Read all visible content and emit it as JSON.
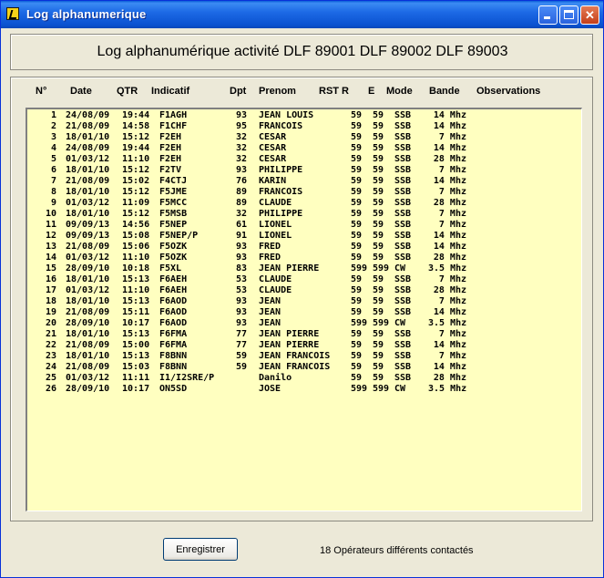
{
  "window": {
    "title": "Log alphanumerique"
  },
  "header": {
    "title": "Log alphanumérique activité  DLF 89001 DLF 89002 DLF 89003"
  },
  "columns": {
    "n": "N°",
    "date": "Date",
    "qtr": "QTR",
    "indicatif": "Indicatif",
    "dpt": "Dpt",
    "prenom": "Prenom",
    "rst_r": "RST R",
    "e": "E",
    "mode": "Mode",
    "bande": "Bande",
    "observations": "Observations"
  },
  "log": [
    {
      "n": "1",
      "date": "24/08/09",
      "qtr": "19:44",
      "ind": "F1AGH",
      "dpt": "93",
      "pre": "JEAN LOUIS",
      "r": "59",
      "e": "59",
      "mode": "SSB",
      "bande": "14 Mhz",
      "obs": ""
    },
    {
      "n": "2",
      "date": "21/08/09",
      "qtr": "14:58",
      "ind": "F1CHF",
      "dpt": "95",
      "pre": "FRANCOIS",
      "r": "59",
      "e": "59",
      "mode": "SSB",
      "bande": "14 Mhz",
      "obs": ""
    },
    {
      "n": "3",
      "date": "18/01/10",
      "qtr": "15:12",
      "ind": "F2EH",
      "dpt": "32",
      "pre": "CESAR",
      "r": "59",
      "e": "59",
      "mode": "SSB",
      "bande": "7 Mhz",
      "obs": ""
    },
    {
      "n": "4",
      "date": "24/08/09",
      "qtr": "19:44",
      "ind": "F2EH",
      "dpt": "32",
      "pre": "CESAR",
      "r": "59",
      "e": "59",
      "mode": "SSB",
      "bande": "14 Mhz",
      "obs": ""
    },
    {
      "n": "5",
      "date": "01/03/12",
      "qtr": "11:10",
      "ind": "F2EH",
      "dpt": "32",
      "pre": "CESAR",
      "r": "59",
      "e": "59",
      "mode": "SSB",
      "bande": "28 Mhz",
      "obs": ""
    },
    {
      "n": "6",
      "date": "18/01/10",
      "qtr": "15:12",
      "ind": "F2TV",
      "dpt": "93",
      "pre": "PHILIPPE",
      "r": "59",
      "e": "59",
      "mode": "SSB",
      "bande": "7 Mhz",
      "obs": ""
    },
    {
      "n": "7",
      "date": "21/08/09",
      "qtr": "15:02",
      "ind": "F4CTJ",
      "dpt": "76",
      "pre": "KARIN",
      "r": "59",
      "e": "59",
      "mode": "SSB",
      "bande": "14 Mhz",
      "obs": ""
    },
    {
      "n": "8",
      "date": "18/01/10",
      "qtr": "15:12",
      "ind": "F5JME",
      "dpt": "89",
      "pre": "FRANCOIS",
      "r": "59",
      "e": "59",
      "mode": "SSB",
      "bande": "7 Mhz",
      "obs": ""
    },
    {
      "n": "9",
      "date": "01/03/12",
      "qtr": "11:09",
      "ind": "F5MCC",
      "dpt": "89",
      "pre": "CLAUDE",
      "r": "59",
      "e": "59",
      "mode": "SSB",
      "bande": "28 Mhz",
      "obs": ""
    },
    {
      "n": "10",
      "date": "18/01/10",
      "qtr": "15:12",
      "ind": "F5MSB",
      "dpt": "32",
      "pre": "PHILIPPE",
      "r": "59",
      "e": "59",
      "mode": "SSB",
      "bande": "7 Mhz",
      "obs": ""
    },
    {
      "n": "11",
      "date": "09/09/13",
      "qtr": "14:56",
      "ind": "F5NEP",
      "dpt": "61",
      "pre": "LIONEL",
      "r": "59",
      "e": "59",
      "mode": "SSB",
      "bande": "7 Mhz",
      "obs": ""
    },
    {
      "n": "12",
      "date": "09/09/13",
      "qtr": "15:08",
      "ind": "F5NEP/P",
      "dpt": "91",
      "pre": "LIONEL",
      "r": "59",
      "e": "59",
      "mode": "SSB",
      "bande": "14 Mhz",
      "obs": ""
    },
    {
      "n": "13",
      "date": "21/08/09",
      "qtr": "15:06",
      "ind": "F5OZK",
      "dpt": "93",
      "pre": "FRED",
      "r": "59",
      "e": "59",
      "mode": "SSB",
      "bande": "14 Mhz",
      "obs": ""
    },
    {
      "n": "14",
      "date": "01/03/12",
      "qtr": "11:10",
      "ind": "F5OZK",
      "dpt": "93",
      "pre": "FRED",
      "r": "59",
      "e": "59",
      "mode": "SSB",
      "bande": "28 Mhz",
      "obs": ""
    },
    {
      "n": "15",
      "date": "28/09/10",
      "qtr": "10:18",
      "ind": "F5XL",
      "dpt": "83",
      "pre": "JEAN PIERRE",
      "r": "599",
      "e": "599",
      "mode": "CW",
      "bande": "3.5 Mhz",
      "obs": ""
    },
    {
      "n": "16",
      "date": "18/01/10",
      "qtr": "15:13",
      "ind": "F6AEH",
      "dpt": "53",
      "pre": "CLAUDE",
      "r": "59",
      "e": "59",
      "mode": "SSB",
      "bande": "7 Mhz",
      "obs": ""
    },
    {
      "n": "17",
      "date": "01/03/12",
      "qtr": "11:10",
      "ind": "F6AEH",
      "dpt": "53",
      "pre": "CLAUDE",
      "r": "59",
      "e": "59",
      "mode": "SSB",
      "bande": "28 Mhz",
      "obs": ""
    },
    {
      "n": "18",
      "date": "18/01/10",
      "qtr": "15:13",
      "ind": "F6AOD",
      "dpt": "93",
      "pre": "JEAN",
      "r": "59",
      "e": "59",
      "mode": "SSB",
      "bande": "7 Mhz",
      "obs": ""
    },
    {
      "n": "19",
      "date": "21/08/09",
      "qtr": "15:11",
      "ind": "F6AOD",
      "dpt": "93",
      "pre": "JEAN",
      "r": "59",
      "e": "59",
      "mode": "SSB",
      "bande": "14 Mhz",
      "obs": ""
    },
    {
      "n": "20",
      "date": "28/09/10",
      "qtr": "10:17",
      "ind": "F6AOD",
      "dpt": "93",
      "pre": "JEAN",
      "r": "599",
      "e": "599",
      "mode": "CW",
      "bande": "3.5 Mhz",
      "obs": ""
    },
    {
      "n": "21",
      "date": "18/01/10",
      "qtr": "15:13",
      "ind": "F6FMA",
      "dpt": "77",
      "pre": "JEAN PIERRE",
      "r": "59",
      "e": "59",
      "mode": "SSB",
      "bande": "7 Mhz",
      "obs": ""
    },
    {
      "n": "22",
      "date": "21/08/09",
      "qtr": "15:00",
      "ind": "F6FMA",
      "dpt": "77",
      "pre": "JEAN PIERRE",
      "r": "59",
      "e": "59",
      "mode": "SSB",
      "bande": "14 Mhz",
      "obs": ""
    },
    {
      "n": "23",
      "date": "18/01/10",
      "qtr": "15:13",
      "ind": "F8BNN",
      "dpt": "59",
      "pre": "JEAN FRANCOIS",
      "r": "59",
      "e": "59",
      "mode": "SSB",
      "bande": "7 Mhz",
      "obs": ""
    },
    {
      "n": "24",
      "date": "21/08/09",
      "qtr": "15:03",
      "ind": "F8BNN",
      "dpt": "59",
      "pre": "JEAN FRANCOIS",
      "r": "59",
      "e": "59",
      "mode": "SSB",
      "bande": "14 Mhz",
      "obs": ""
    },
    {
      "n": "25",
      "date": "01/03/12",
      "qtr": "11:11",
      "ind": "I1/I2SRE/P",
      "dpt": "",
      "pre": "Danilo",
      "r": "59",
      "e": "59",
      "mode": "SSB",
      "bande": "28 Mhz",
      "obs": ""
    },
    {
      "n": "26",
      "date": "28/09/10",
      "qtr": "10:17",
      "ind": "ON5SD",
      "dpt": "",
      "pre": "JOSE",
      "r": "599",
      "e": "599",
      "mode": "CW",
      "bande": "3.5 Mhz",
      "obs": ""
    }
  ],
  "footer": {
    "save_label": "Enregistrer",
    "status": "18  Opérateurs différents contactés"
  }
}
